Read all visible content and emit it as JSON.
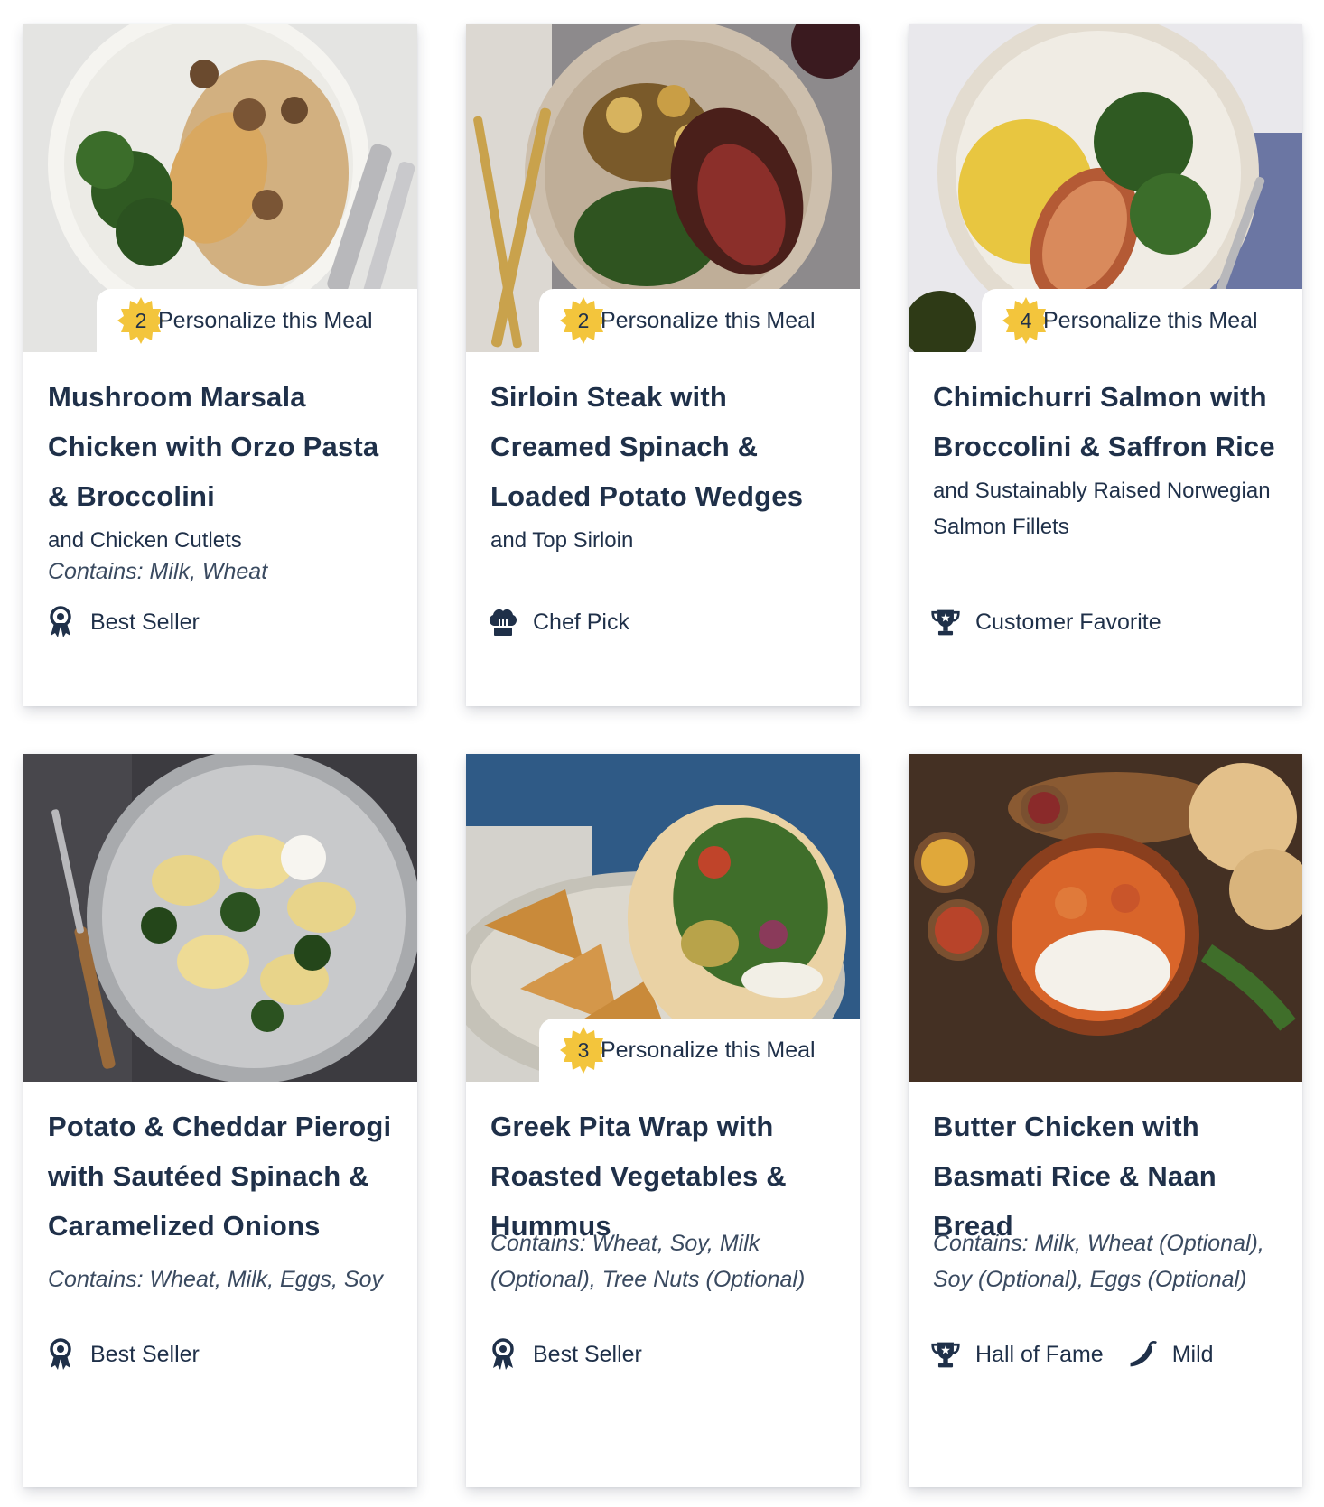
{
  "colors": {
    "text": "#1f3049",
    "seal": "#f3c53c",
    "card_bg": "#ffffff"
  },
  "meals": [
    {
      "title": "Mushroom Marsala Chicken with Orzo Pasta & Broccolini",
      "subtitle": "and Chicken Cutlets",
      "contains": "Contains: Milk, Wheat",
      "personalize": {
        "count": "2",
        "label": "Personalize this Meal"
      },
      "badges": [
        {
          "icon": "award-ribbon-icon",
          "label": "Best Seller"
        }
      ]
    },
    {
      "title": "Sirloin Steak with Creamed Spinach & Loaded Potato Wedges",
      "subtitle": "and Top Sirloin",
      "contains": "",
      "personalize": {
        "count": "2",
        "label": "Personalize this Meal"
      },
      "badges": [
        {
          "icon": "chef-hat-icon",
          "label": "Chef Pick"
        }
      ]
    },
    {
      "title": "Chimichurri Salmon with Broccolini & Saffron Rice",
      "subtitle": "and Sustainably Raised Norwegian Salmon Fillets",
      "contains": "",
      "personalize": {
        "count": "4",
        "label": "Personalize this Meal"
      },
      "badges": [
        {
          "icon": "trophy-icon",
          "label": "Customer Favorite"
        }
      ]
    },
    {
      "title": "Potato & Cheddar Pierogi with Sautéed Spinach & Caramelized Onions",
      "subtitle": "",
      "contains": "Contains: Wheat, Milk, Eggs, Soy",
      "personalize": null,
      "badges": [
        {
          "icon": "award-ribbon-icon",
          "label": "Best Seller"
        }
      ]
    },
    {
      "title": "Greek Pita Wrap with Roasted Vegetables & Hummus",
      "subtitle": "",
      "contains": "Contains: Wheat, Soy, Milk (Optional), Tree Nuts (Optional)",
      "personalize": {
        "count": "3",
        "label": "Personalize this Meal"
      },
      "badges": [
        {
          "icon": "award-ribbon-icon",
          "label": "Best Seller"
        }
      ]
    },
    {
      "title": "Butter Chicken with Basmati Rice & Naan Bread",
      "subtitle": "",
      "contains": "Contains: Milk, Wheat (Optional), Soy (Optional), Eggs (Optional)",
      "personalize": null,
      "badges": [
        {
          "icon": "trophy-icon",
          "label": "Hall of Fame"
        },
        {
          "icon": "chili-pepper-icon",
          "label": "Mild"
        }
      ]
    }
  ]
}
